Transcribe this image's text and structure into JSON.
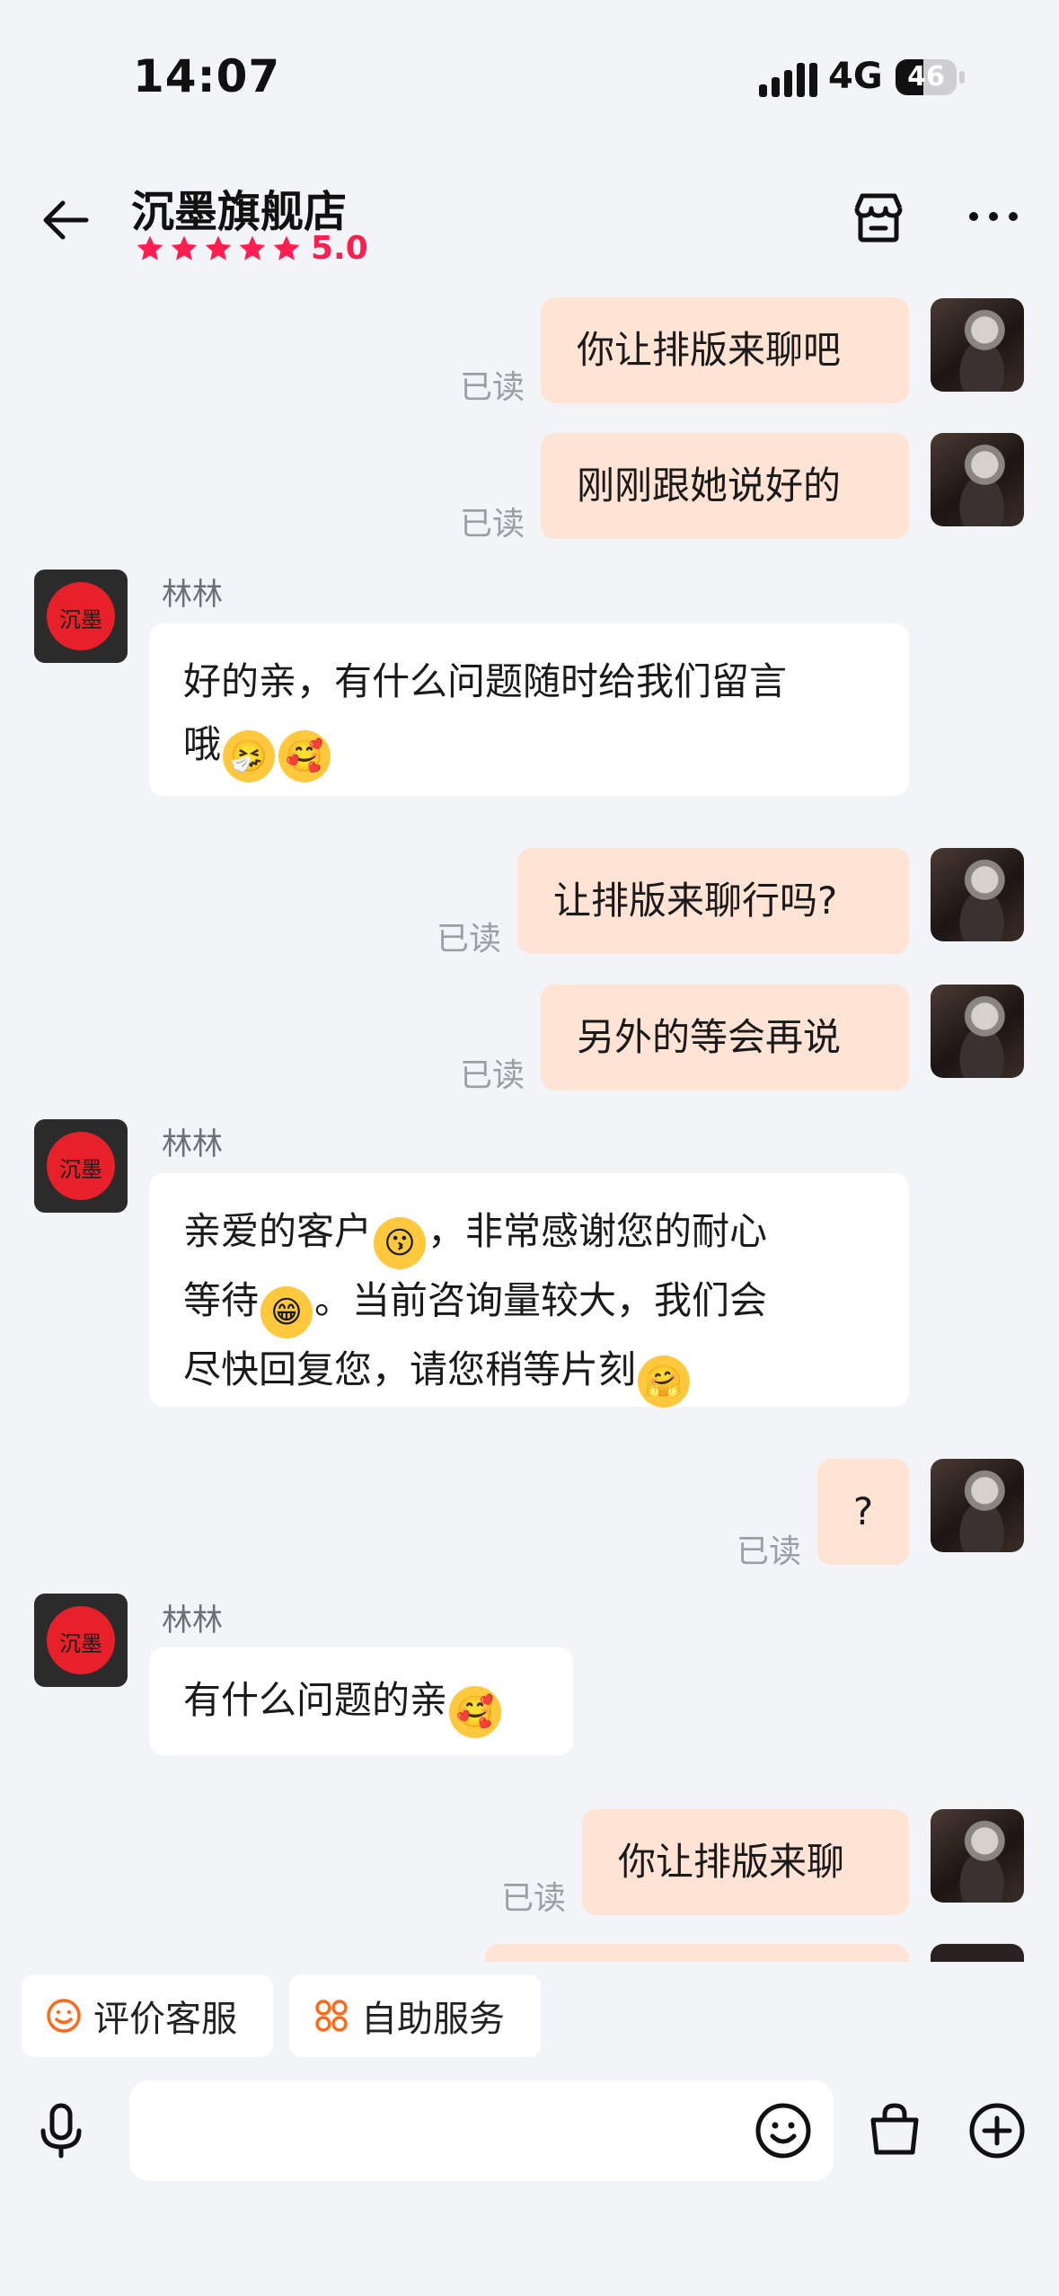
{
  "status_bar": {
    "time": "14:07",
    "network": "4G",
    "battery": "46"
  },
  "header": {
    "shop_name": "沉墨旗舰店",
    "rating": "5.0",
    "stars": 5
  },
  "shop_avatar_text": "沉墨",
  "messages": [
    {
      "from": "me",
      "text": "你让排版来聊吧",
      "read": "已读"
    },
    {
      "from": "me",
      "text": "刚刚跟她说好的",
      "read": "已读"
    },
    {
      "from": "shop",
      "sender": "林林",
      "text": "好的亲，有什么问题随时给我们留言",
      "text2": "哦",
      "emojis": [
        "🤧",
        "🥰"
      ]
    },
    {
      "from": "me",
      "text": "让排版来聊行吗?",
      "read": "已读"
    },
    {
      "from": "me",
      "text": "另外的等会再说",
      "read": "已读"
    },
    {
      "from": "shop",
      "sender": "林林",
      "line1": "亲爱的客户",
      "line1b": "，非常感谢您的耐心",
      "line2": "等待",
      "line2b": "。当前咨询量较大，我们会",
      "line3": "尽快回复您，请您稍等片刻",
      "emojis": [
        "😗",
        "😁",
        "🤗"
      ]
    },
    {
      "from": "me",
      "text": "?",
      "read": "已读"
    },
    {
      "from": "shop",
      "sender": "林林",
      "text": "有什么问题的亲",
      "emojis": [
        "🥰"
      ]
    },
    {
      "from": "me",
      "text": "你让排版来聊",
      "read": "已读"
    }
  ],
  "quick_actions": {
    "rate": "评价客服",
    "self_service": "自助服务"
  },
  "colors": {
    "accent": "#ff1e50",
    "bubble_me": "#ffe3d4",
    "background": "#f2f4f7"
  }
}
